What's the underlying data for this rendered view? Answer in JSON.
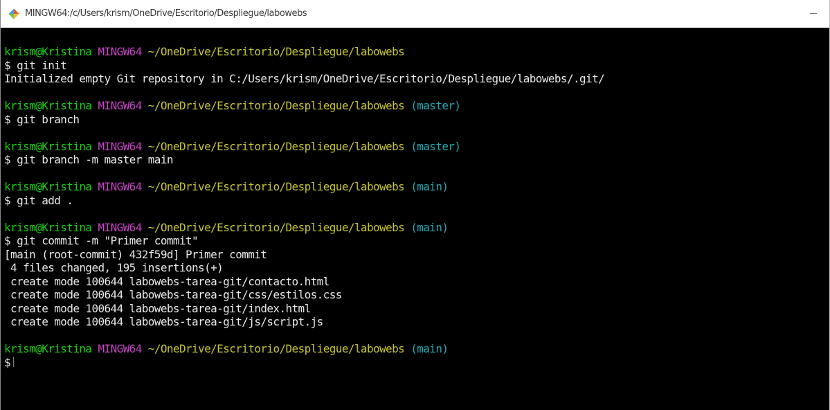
{
  "window": {
    "title": "MINGW64:/c/Users/krism/OneDrive/Escritorio/Despliegue/labowebs",
    "icon": "git-bash-icon",
    "minimize_symbol": "—"
  },
  "colors": {
    "user_host": "#19cd0f",
    "shell": "#c844c6",
    "path": "#c7c42f",
    "branch": "#22a9b3",
    "output": "#e8e8e8",
    "background": "#000000"
  },
  "terminal": {
    "blocks": [
      {
        "prompt": {
          "user": "krism@Kristina",
          "shell": "MINGW64",
          "path": "~/OneDrive/Escritorio/Despliegue/labowebs",
          "branch": ""
        },
        "command": "$ git init",
        "output": [
          "Initialized empty Git repository in C:/Users/krism/OneDrive/Escritorio/Despliegue/labowebs/.git/"
        ]
      },
      {
        "prompt": {
          "user": "krism@Kristina",
          "shell": "MINGW64",
          "path": "~/OneDrive/Escritorio/Despliegue/labowebs",
          "branch": "(master)"
        },
        "command": "$ git branch",
        "output": []
      },
      {
        "prompt": {
          "user": "krism@Kristina",
          "shell": "MINGW64",
          "path": "~/OneDrive/Escritorio/Despliegue/labowebs",
          "branch": "(master)"
        },
        "command": "$ git branch -m master main",
        "output": []
      },
      {
        "prompt": {
          "user": "krism@Kristina",
          "shell": "MINGW64",
          "path": "~/OneDrive/Escritorio/Despliegue/labowebs",
          "branch": "(main)"
        },
        "command": "$ git add .",
        "output": []
      },
      {
        "prompt": {
          "user": "krism@Kristina",
          "shell": "MINGW64",
          "path": "~/OneDrive/Escritorio/Despliegue/labowebs",
          "branch": "(main)"
        },
        "command": "$ git commit -m \"Primer commit\"",
        "output": [
          "[main (root-commit) 432f59d] Primer commit",
          " 4 files changed, 195 insertions(+)",
          " create mode 100644 labowebs-tarea-git/contacto.html",
          " create mode 100644 labowebs-tarea-git/css/estilos.css",
          " create mode 100644 labowebs-tarea-git/index.html",
          " create mode 100644 labowebs-tarea-git/js/script.js"
        ]
      },
      {
        "prompt": {
          "user": "krism@Kristina",
          "shell": "MINGW64",
          "path": "~/OneDrive/Escritorio/Despliegue/labowebs",
          "branch": "(main)"
        },
        "command": "$",
        "output": [],
        "has_cursor": true
      }
    ]
  }
}
